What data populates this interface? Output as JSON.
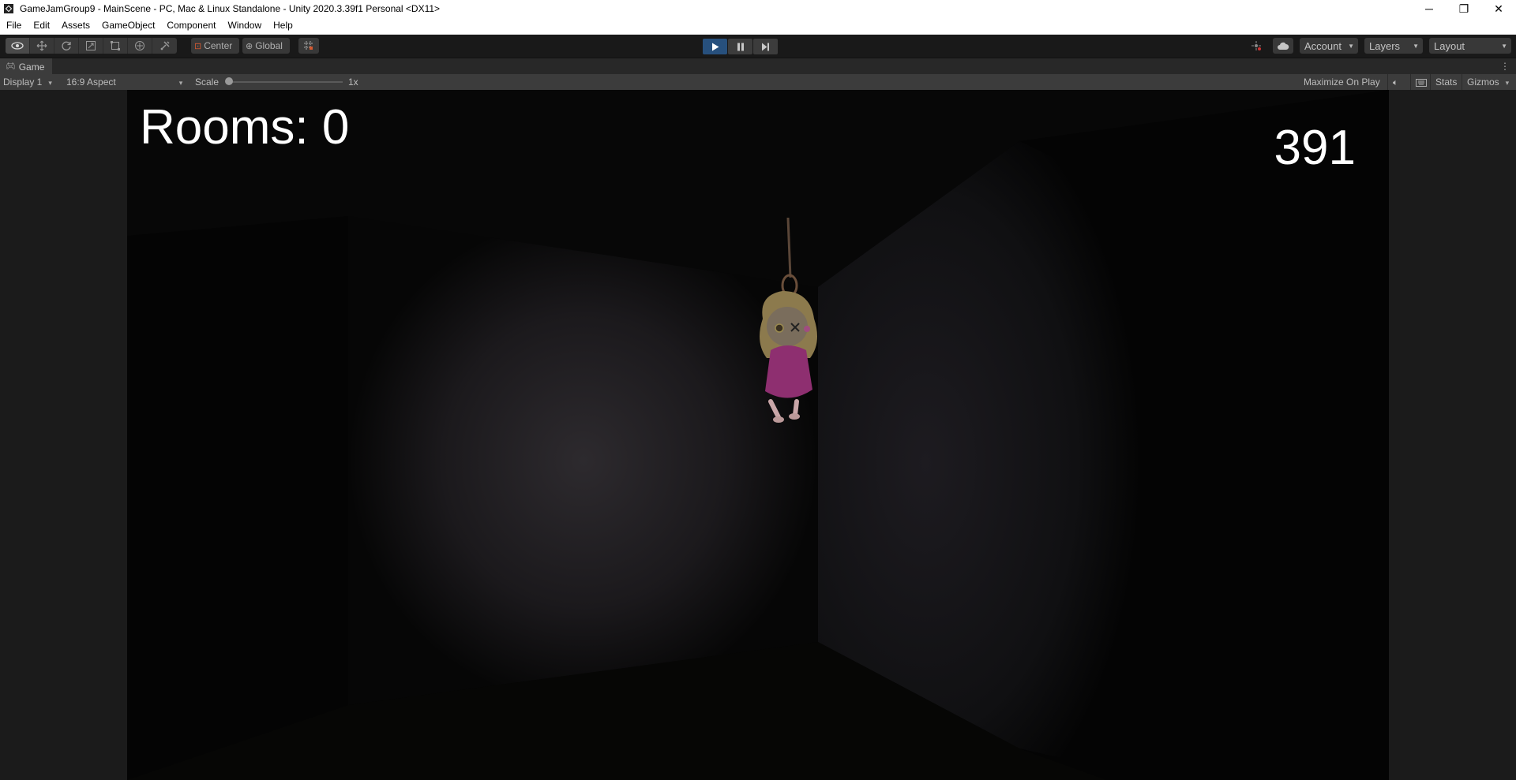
{
  "window": {
    "title": "GameJamGroup9 - MainScene - PC, Mac & Linux Standalone - Unity 2020.3.39f1 Personal <DX11>",
    "controls": {
      "minimize": "─",
      "maximize": "❐",
      "close": "✕"
    }
  },
  "menu": {
    "items": [
      "File",
      "Edit",
      "Assets",
      "GameObject",
      "Component",
      "Window",
      "Help"
    ]
  },
  "toolbar": {
    "tools": [
      "view-icon",
      "move-icon",
      "rotate-icon",
      "scale-icon",
      "rect-icon",
      "transform-icon",
      "custom-tool-icon"
    ],
    "pivot_label": "Center",
    "space_label": "Global",
    "account_label": "Account",
    "layers_label": "Layers",
    "layout_label": "Layout"
  },
  "tab": {
    "label": "Game"
  },
  "game_bar": {
    "display": "Display 1",
    "aspect": "16:9 Aspect",
    "scale_label": "Scale",
    "scale_value": "1x",
    "maximize_label": "Maximize On Play",
    "stats_label": "Stats",
    "gizmos_label": "Gizmos"
  },
  "game": {
    "rooms_text": "Rooms: 0",
    "timer": "391"
  },
  "colors": {
    "play_active": "#27507d",
    "editor_bg": "#191919",
    "panel_bg": "#3c3c3c"
  }
}
